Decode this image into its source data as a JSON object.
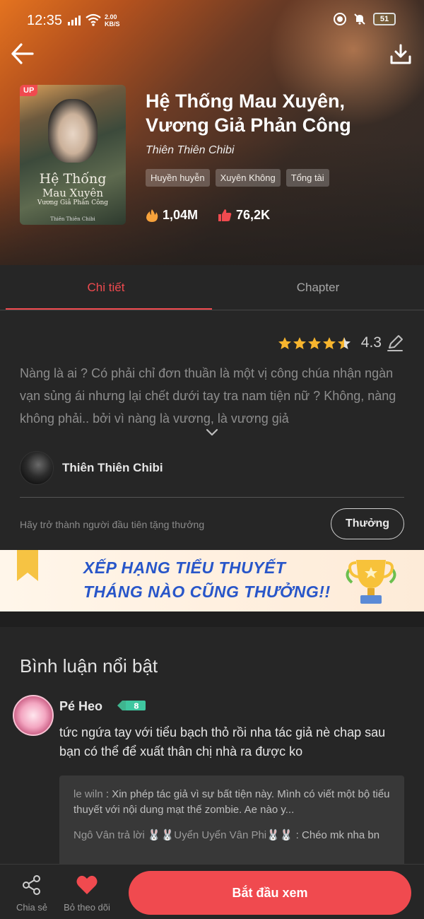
{
  "status_bar": {
    "time": "12:35",
    "speed_value": "2.00",
    "speed_unit": "KB/S",
    "battery": "51"
  },
  "book": {
    "cover_badge": "UP",
    "cover_title_line1": "Hệ Thống",
    "cover_title_line2": "Mau Xuyên",
    "cover_title_line3": "Vương Giả Phản Công",
    "cover_author": "Thiên Thiên Chibi",
    "title": "Hệ Thống Mau Xuyên, Vương Giả Phản Công",
    "author": "Thiên Thiên Chibi",
    "tags": [
      "Huyền huyễn",
      "Xuyên Không",
      "Tổng tài"
    ],
    "views": "1,04M",
    "likes": "76,2K"
  },
  "tabs": [
    {
      "label": "Chi tiết",
      "active": true
    },
    {
      "label": "Chapter",
      "active": false
    }
  ],
  "detail": {
    "rating": "4.3",
    "stars": 4.5,
    "synopsis": "Nàng là ai ? Có phải chỉ đơn thuần là một vị công chúa nhận ngàn vạn sủng ái nhưng lại chết dưới tay tra nam tiện nữ ? Không, nàng không phải.. bởi vì nàng là vương, là vương giả",
    "author_name": "Thiên Thiên Chibi",
    "gift_prompt": "Hãy trở thành người đầu tiên tặng thưởng",
    "gift_button": "Thưởng"
  },
  "banner": {
    "line1": "XẾP HẠNG TIỂU THUYẾT",
    "line2": "THÁNG NÀO CŨNG THƯỞNG!!"
  },
  "comments": {
    "heading": "Bình luận nổi bật",
    "items": [
      {
        "user": "Pé Heo",
        "level": "8",
        "text": "tức ngứa tay với tiểu bạch thỏ rồi nha tác giả nè chap sau bạn có thể để xuất thân chị nhà ra được ko",
        "replies": [
          {
            "name": "le wiln",
            "text": "Xin phép tác giả vì sự bất tiện này. Mình có viết một bộ tiểu thuyết với nội dung mạt thế zombie. Ae nào y..."
          },
          {
            "name": "Ngô Vân trả lời 🐰🐰Uyển Uyển Vân Phi🐰🐰",
            "text": "Chéo mk nha bn"
          }
        ]
      }
    ]
  },
  "bottom_bar": {
    "share_label": "Chia sẻ",
    "follow_label": "Bỏ theo dõi",
    "start_label": "Bắt đầu xem"
  },
  "colors": {
    "accent": "#f04a4f",
    "background": "#262626",
    "banner_text": "#2856c9"
  }
}
